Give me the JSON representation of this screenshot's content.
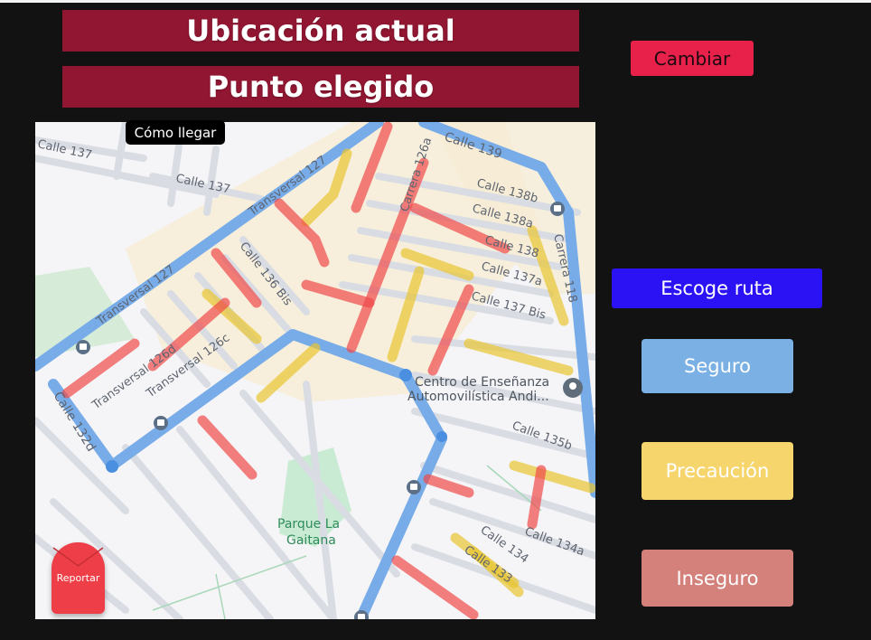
{
  "header": {
    "current_location": "Ubicación actual",
    "chosen_point": "Punto elegido",
    "change_button": "Cambiar"
  },
  "map": {
    "directions_label": "Cómo llegar",
    "report_button": "Reportar",
    "streets": {
      "calle_137_a": "Calle 137",
      "calle_137_b": "Calle 137",
      "calle_139": "Calle 139",
      "transversal_127_top": "Transversal 127",
      "transversal_127_left": "Transversal 127",
      "carrera_126a": "Carrera 126a",
      "calle_138b": "Calle 138b",
      "calle_138a": "Calle 138a",
      "calle_138": "Calle 138",
      "calle_137a": "Calle 137a",
      "calle_137bis": "Calle 137 Bis",
      "carrera_118": "Carrera 118",
      "calle_136bis": "Calle 136 Bis",
      "transversal_126d": "Transversal 126d",
      "transversal_126c": "Transversal 126c",
      "calle_132d": "Calle 132d",
      "calle_135b": "Calle 135b",
      "calle_134": "Calle 134",
      "calle_134a": "Calle 134a",
      "calle_133": "Calle 133"
    },
    "poi": {
      "school_line1": "Centro de Enseñanza",
      "school_line2": "Automovilística Andi...",
      "park_line1": "Parque La",
      "park_line2": "Gaitana"
    },
    "icons": [
      "bus-stop-icon",
      "map-pin-icon",
      "mail-icon"
    ]
  },
  "route": {
    "choose_label": "Escoge ruta",
    "safe": "Seguro",
    "caution": "Precaución",
    "unsafe": "Inseguro"
  },
  "colors": {
    "banner": "#911632",
    "change": "#e8214a",
    "choose": "#2b12f5",
    "safe": "#7ab0e3",
    "caution": "#f5d56c",
    "unsafe": "#d4807b",
    "report": "#ee3e47"
  }
}
